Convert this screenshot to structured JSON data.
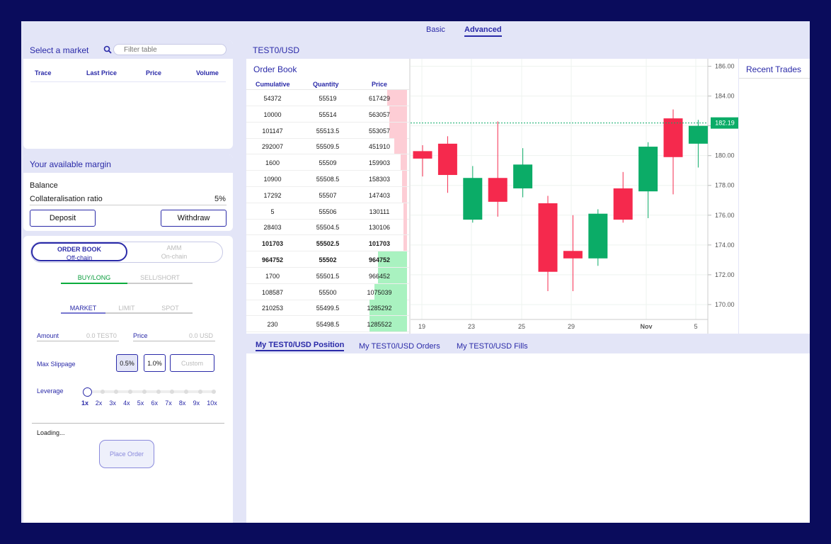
{
  "top_tabs": {
    "basic": "Basic",
    "advanced": "Advanced"
  },
  "market_select": {
    "title": "Select a market",
    "search_placeholder": "Filter table",
    "columns": [
      "Trace",
      "Last Price",
      "Price",
      "Volume"
    ]
  },
  "margin": {
    "title": "Your available margin",
    "balance_label": "Balance",
    "collat_label": "Collateralisation ratio",
    "collat_value": "5%",
    "deposit": "Deposit",
    "withdraw": "Withdraw"
  },
  "order_form": {
    "mode_left": "ORDER BOOK",
    "mode_left_sub": "Off-chain",
    "mode_right": "AMM",
    "mode_right_sub": "On-chain",
    "side_buy": "BUY/LONG",
    "side_sell": "SELL/SHORT",
    "type_market": "MARKET",
    "type_limit": "LIMIT",
    "type_spot": "SPOT",
    "amount_label": "Amount",
    "amount_placeholder": "0.0 TEST0",
    "price_label": "Price",
    "price_placeholder": "0.0 USD",
    "slippage_label": "Max Slippage",
    "slip_1": "0.5%",
    "slip_2": "1.0%",
    "slip_custom": "Custom",
    "leverage_label": "Leverage",
    "leverage_options": [
      "1x",
      "2x",
      "3x",
      "4x",
      "5x",
      "6x",
      "7x",
      "8x",
      "9x",
      "10x"
    ],
    "leverage_selected": "1x",
    "loading": "Loading...",
    "place_order": "Place Order"
  },
  "market_header": {
    "title": "TEST0/USD"
  },
  "order_book": {
    "title": "Order Book",
    "columns": [
      "Cumulative",
      "Quantity",
      "Price"
    ],
    "asks": [
      {
        "cum": "54372",
        "qty": "55519",
        "price": "617429",
        "depth": 0.12
      },
      {
        "cum": "10000",
        "qty": "55514",
        "price": "563057",
        "depth": 0.11
      },
      {
        "cum": "101147",
        "qty": "55513.5",
        "price": "553057",
        "depth": 0.11
      },
      {
        "cum": "292007",
        "qty": "55509.5",
        "price": "451910",
        "depth": 0.08
      },
      {
        "cum": "1600",
        "qty": "55509",
        "price": "159903",
        "depth": 0.04
      },
      {
        "cum": "10900",
        "qty": "55508.5",
        "price": "158303",
        "depth": 0.03
      },
      {
        "cum": "17292",
        "qty": "55507",
        "price": "147403",
        "depth": 0.03
      },
      {
        "cum": "5",
        "qty": "55506",
        "price": "130111",
        "depth": 0.02
      },
      {
        "cum": "28403",
        "qty": "55504.5",
        "price": "130106",
        "depth": 0.02
      },
      {
        "cum": "101703",
        "qty": "55502.5",
        "price": "101703",
        "depth": 0.02,
        "bold": true
      }
    ],
    "bids": [
      {
        "cum": "964752",
        "qty": "55502",
        "price": "964752",
        "depth": 0.18,
        "bold": true
      },
      {
        "cum": "1700",
        "qty": "55501.5",
        "price": "966452",
        "depth": 0.18
      },
      {
        "cum": "108587",
        "qty": "55500",
        "price": "1075039",
        "depth": 0.2
      },
      {
        "cum": "210253",
        "qty": "55499.5",
        "price": "1285292",
        "depth": 0.23
      },
      {
        "cum": "230",
        "qty": "55498.5",
        "price": "1285522",
        "depth": 0.23
      }
    ]
  },
  "chart_data": {
    "type": "candlestick",
    "x_ticks": [
      "19",
      "23",
      "25",
      "29",
      "Nov",
      "5"
    ],
    "ylim": [
      169,
      186.5
    ],
    "y_ticks": [
      "186.00",
      "184.00",
      "182.00",
      "180.00",
      "178.00",
      "176.00",
      "174.00",
      "172.00",
      "170.00"
    ],
    "last_price": "182.19",
    "candles": [
      {
        "o": 180.3,
        "h": 180.7,
        "l": 178.6,
        "c": 179.8
      },
      {
        "o": 180.8,
        "h": 181.3,
        "l": 177.5,
        "c": 178.7
      },
      {
        "o": 175.7,
        "h": 179.3,
        "l": 175.5,
        "c": 178.5
      },
      {
        "o": 178.5,
        "h": 182.3,
        "l": 175.9,
        "c": 176.9
      },
      {
        "o": 177.8,
        "h": 180.5,
        "l": 177.2,
        "c": 179.4
      },
      {
        "o": 176.8,
        "h": 177.3,
        "l": 170.9,
        "c": 172.2
      },
      {
        "o": 173.6,
        "h": 176.0,
        "l": 170.9,
        "c": 173.1
      },
      {
        "o": 173.1,
        "h": 176.4,
        "l": 172.6,
        "c": 176.1
      },
      {
        "o": 177.8,
        "h": 178.9,
        "l": 175.5,
        "c": 175.7
      },
      {
        "o": 177.6,
        "h": 180.9,
        "l": 175.8,
        "c": 180.6
      },
      {
        "o": 182.5,
        "h": 183.1,
        "l": 177.4,
        "c": 179.9
      },
      {
        "o": 180.8,
        "h": 182.4,
        "l": 179.2,
        "c": 182.0
      }
    ],
    "up_color": "#0bac67",
    "down_color": "#f5294d"
  },
  "recent_trades": {
    "title": "Recent Trades"
  },
  "bottom_tabs": [
    "My TEST0/USD Position",
    "My TEST0/USD Orders",
    "My TEST0/USD Fills"
  ],
  "colors": {
    "accent": "#2a2aa8",
    "panel": "#e3e5f7",
    "frame": "#0a0c5c"
  }
}
